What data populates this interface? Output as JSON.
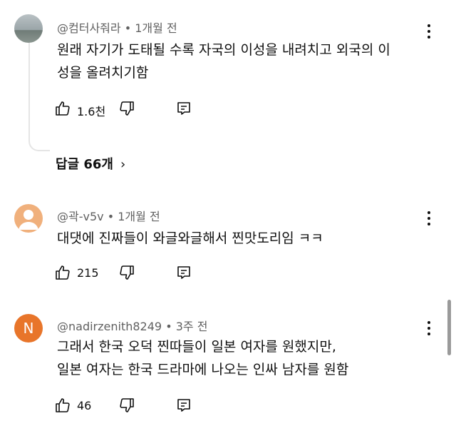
{
  "comments": [
    {
      "author": "@컴터사줘라",
      "time": "1개월 전",
      "text_lines": [
        "원래 자기가 도태될 수록 자국의 이성을 내려치고 외국의 이",
        "성을 올려치기함"
      ],
      "likes": "1.6천",
      "avatar_type": "photo",
      "replies_label": "답글 66개"
    },
    {
      "author": "@곽-v5v",
      "time": "1개월 전",
      "text_lines": [
        "대댓에 진짜들이 와글와글해서 찐맛도리임 ㅋㅋ"
      ],
      "likes": "215",
      "avatar_type": "person"
    },
    {
      "author": "@nadirzenith8249",
      "time": "3주 전",
      "text_lines": [
        "그래서 한국 오덕 찐따들이 일본 여자를 원했지만,",
        "일본 여자는 한국 드라마에 나오는 인싸 남자를 원함"
      ],
      "likes": "46",
      "avatar_type": "letter",
      "avatar_letter": "N",
      "avatar_color": "#e8752a"
    }
  ],
  "separator": "•",
  "replies_chevron": "›"
}
